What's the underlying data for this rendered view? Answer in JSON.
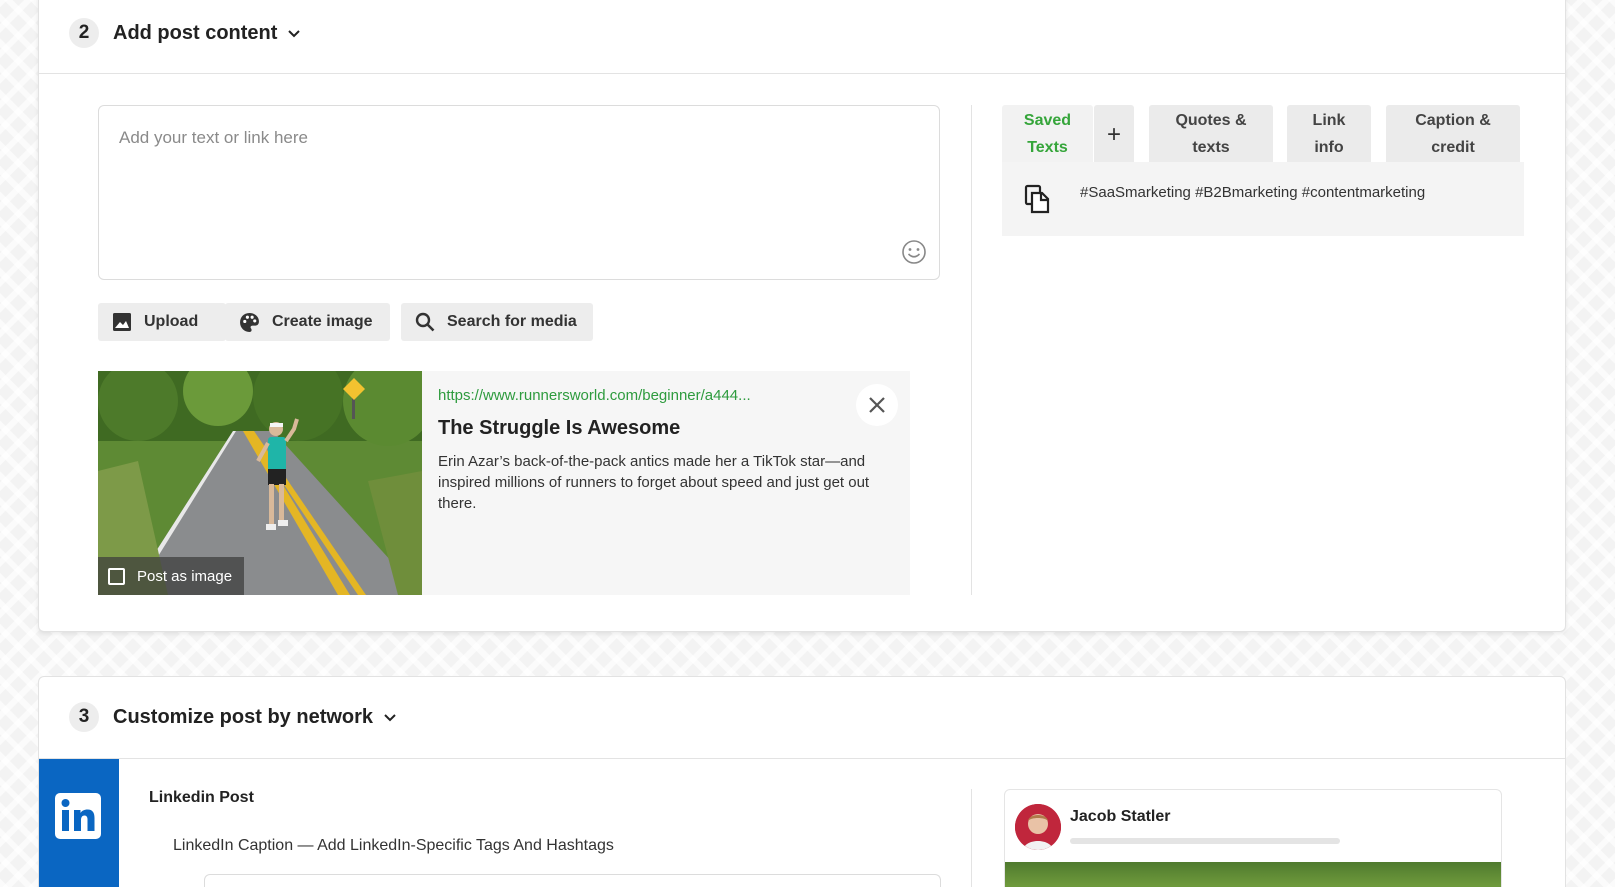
{
  "add_content": {
    "step": "2",
    "title": "Add post content",
    "text_placeholder": "Add your text or link here",
    "buttons": {
      "upload": "Upload",
      "create_image": "Create image",
      "search_media": "Search for media"
    },
    "link_preview": {
      "url": "https://www.runnersworld.com/beginner/a444...",
      "title": "The Struggle Is Awesome",
      "description": "Erin Azar’s back-of-the-pack antics made her a TikTok star—and inspired millions of runners to forget about speed and just get out there.",
      "post_as_image": "Post as image"
    },
    "tabs": {
      "saved_texts": "Saved Texts",
      "add": "+",
      "quotes": "Quotes & texts",
      "link_info": "Link info",
      "caption": "Caption & credit"
    },
    "saved_text_item": "#SaaSmarketing #B2Bmarketing #contentmarketing"
  },
  "customize": {
    "step": "3",
    "title": "Customize post by network",
    "linkedin": {
      "logo_text": "in",
      "post_title": "Linkedin Post",
      "caption_label": "LinkedIn Caption — Add LinkedIn-Specific Tags And Hashtags",
      "user_name": "Jacob Statler"
    }
  },
  "colors": {
    "accent_green": "#35a53a",
    "link_green": "#2e9b3e",
    "linkedin_blue": "#0a66c2"
  }
}
